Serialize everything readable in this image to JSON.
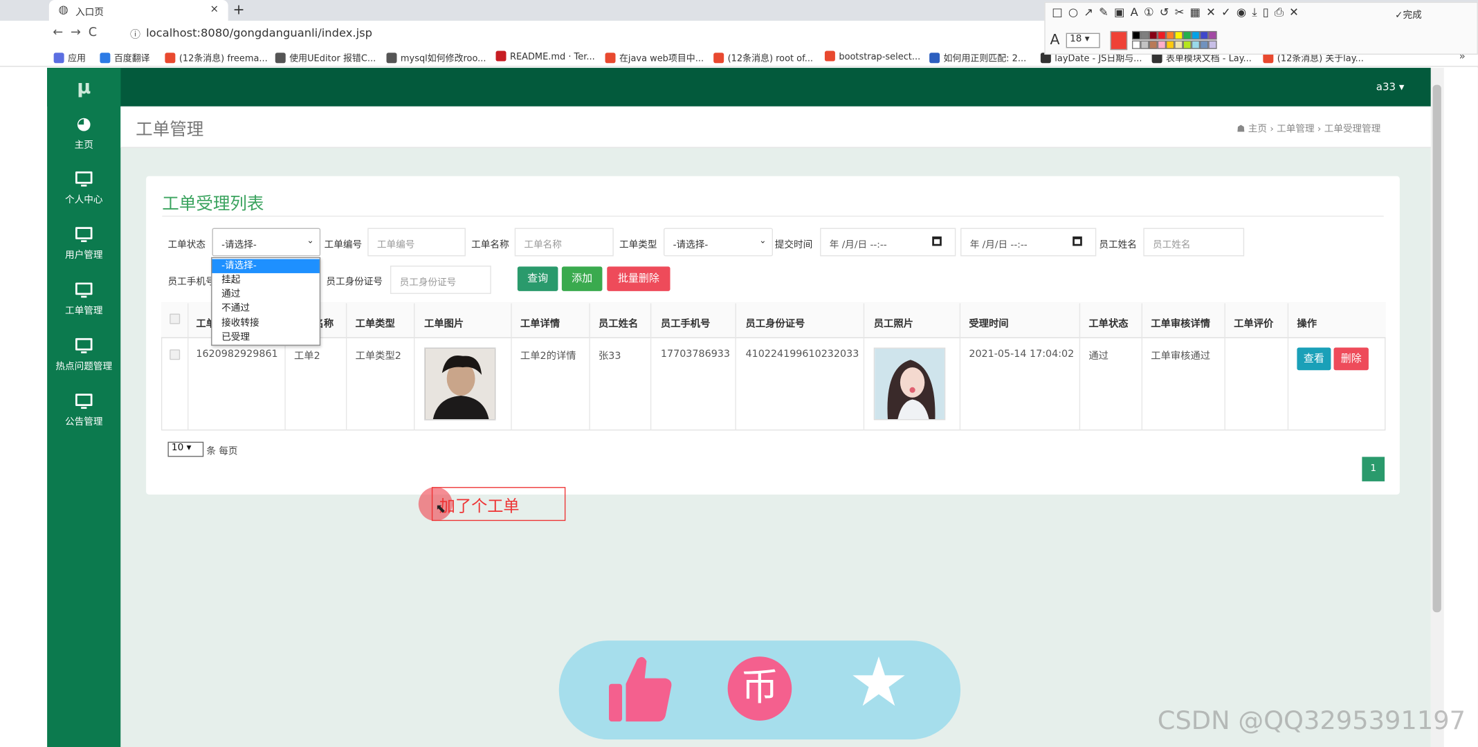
{
  "browser": {
    "tab_title": "入口页",
    "tab_close": "×",
    "new_tab": "+",
    "nav_glyphs": "←→C",
    "info_glyph": "ⓘ",
    "url": "localhost:8080/gongdanguanli/index.jsp",
    "bookmarks": [
      {
        "label": "应用",
        "color": "#5b6ee1"
      },
      {
        "label": "百度翻译",
        "color": "#2d7be5"
      },
      {
        "label": "(12条消息) freema...",
        "color": "#e8492f"
      },
      {
        "label": "使用UEditor 报错C...",
        "color": "#555555"
      },
      {
        "label": "mysql如何修改roo...",
        "color": "#555555"
      },
      {
        "label": "README.md · Ter...",
        "color": "#c71d23"
      },
      {
        "label": "在java web项目中...",
        "color": "#e8492f"
      },
      {
        "label": "(12条消息) root of...",
        "color": "#e8492f"
      },
      {
        "label": "bootstrap-select...",
        "color": "#e8492f"
      },
      {
        "label": "如何用正则匹配: 2...",
        "color": "#2d5fbf"
      },
      {
        "label": "layDate - JS日期与...",
        "color": "#333333"
      },
      {
        "label": "表单模块文档 - Lay...",
        "color": "#333333"
      },
      {
        "label": "(12条消息) 关于lay...",
        "color": "#e8492f"
      }
    ],
    "bookmarks_more": "»",
    "annotation_tools": "□○↗✎▣A①↺✂▦✕✓◉⤓▯⎙✕",
    "annotation_done": "完成",
    "font_letter": "A",
    "font_size": "18 ▾",
    "current_color": "#ef4136",
    "star_glyph": "☆",
    "user_glyph": "●"
  },
  "app": {
    "logo": "μ",
    "user_menu": "a33 ▾",
    "sidebar": [
      {
        "label": "主页",
        "icon": "dashboard-icon"
      },
      {
        "label": "个人中心",
        "icon": "monitor-icon"
      },
      {
        "label": "用户管理",
        "icon": "monitor-icon"
      },
      {
        "label": "工单管理",
        "icon": "monitor-icon"
      },
      {
        "label": "热点问题管理",
        "icon": "monitor-icon"
      },
      {
        "label": "公告管理",
        "icon": "monitor-icon"
      }
    ],
    "page_title": "工单管理",
    "breadcrumb": "☗ 主页  ›  工单管理  ›  工单受理管理",
    "panel_title": "工单受理列表"
  },
  "filters": {
    "status_label": "工单状态",
    "status_value": "-请选择-",
    "code_label": "工单编号",
    "code_placeholder": "工单编号",
    "name_label": "工单名称",
    "name_placeholder": "工单名称",
    "type_label": "工单类型",
    "type_value": "-请选择-",
    "submit_time_label": "提交时间",
    "date_placeholder": "年 /月/日 --:--",
    "staff_name_label": "员工姓名",
    "staff_name_placeholder": "员工姓名",
    "phone_label": "员工手机号",
    "id_label": "员工身份证号",
    "id_placeholder": "员工身份证号",
    "query_button": "查询",
    "add_button": "添加",
    "batch_delete_button": "批量删除",
    "status_options": [
      "-请选择-",
      "挂起",
      "通过",
      "不通过",
      "接收转接",
      "已受理"
    ]
  },
  "table": {
    "headers": [
      "工单编号",
      "工单名称",
      "工单类型",
      "工单图片",
      "工单详情",
      "员工姓名",
      "员工手机号",
      "员工身份证号",
      "员工照片",
      "受理时间",
      "工单状态",
      "工单审核详情",
      "工单评价",
      "操作"
    ],
    "rows": [
      {
        "code": "1620982929861",
        "name": "工单2",
        "type": "工单类型2",
        "detail": "工单2的详情",
        "staff_name": "张33",
        "phone": "17703786933",
        "id_number": "410224199610232033",
        "accept_time": "2021-05-14 17:04:02",
        "status": "通过",
        "review_detail": "工单审核通过",
        "rating": "",
        "view_button": "查看",
        "delete_button": "删除"
      }
    ]
  },
  "pagination": {
    "per_page": "10 ▾",
    "per_page_label": "条 每页",
    "current_page": "1"
  },
  "annotation_text": "加了个工单",
  "like_bar": {
    "coin_glyph": "币",
    "star_glyph": "★"
  },
  "watermark": "CSDN @QQ3295391197",
  "colors": {
    "sidebar": "#0c7a4e",
    "topnav": "#035a3c",
    "query": "#2a9a6c",
    "add": "#3aaa4e",
    "danger": "#ee4b5a",
    "view": "#1aa0b8",
    "panel_title": "#3aa35e"
  }
}
